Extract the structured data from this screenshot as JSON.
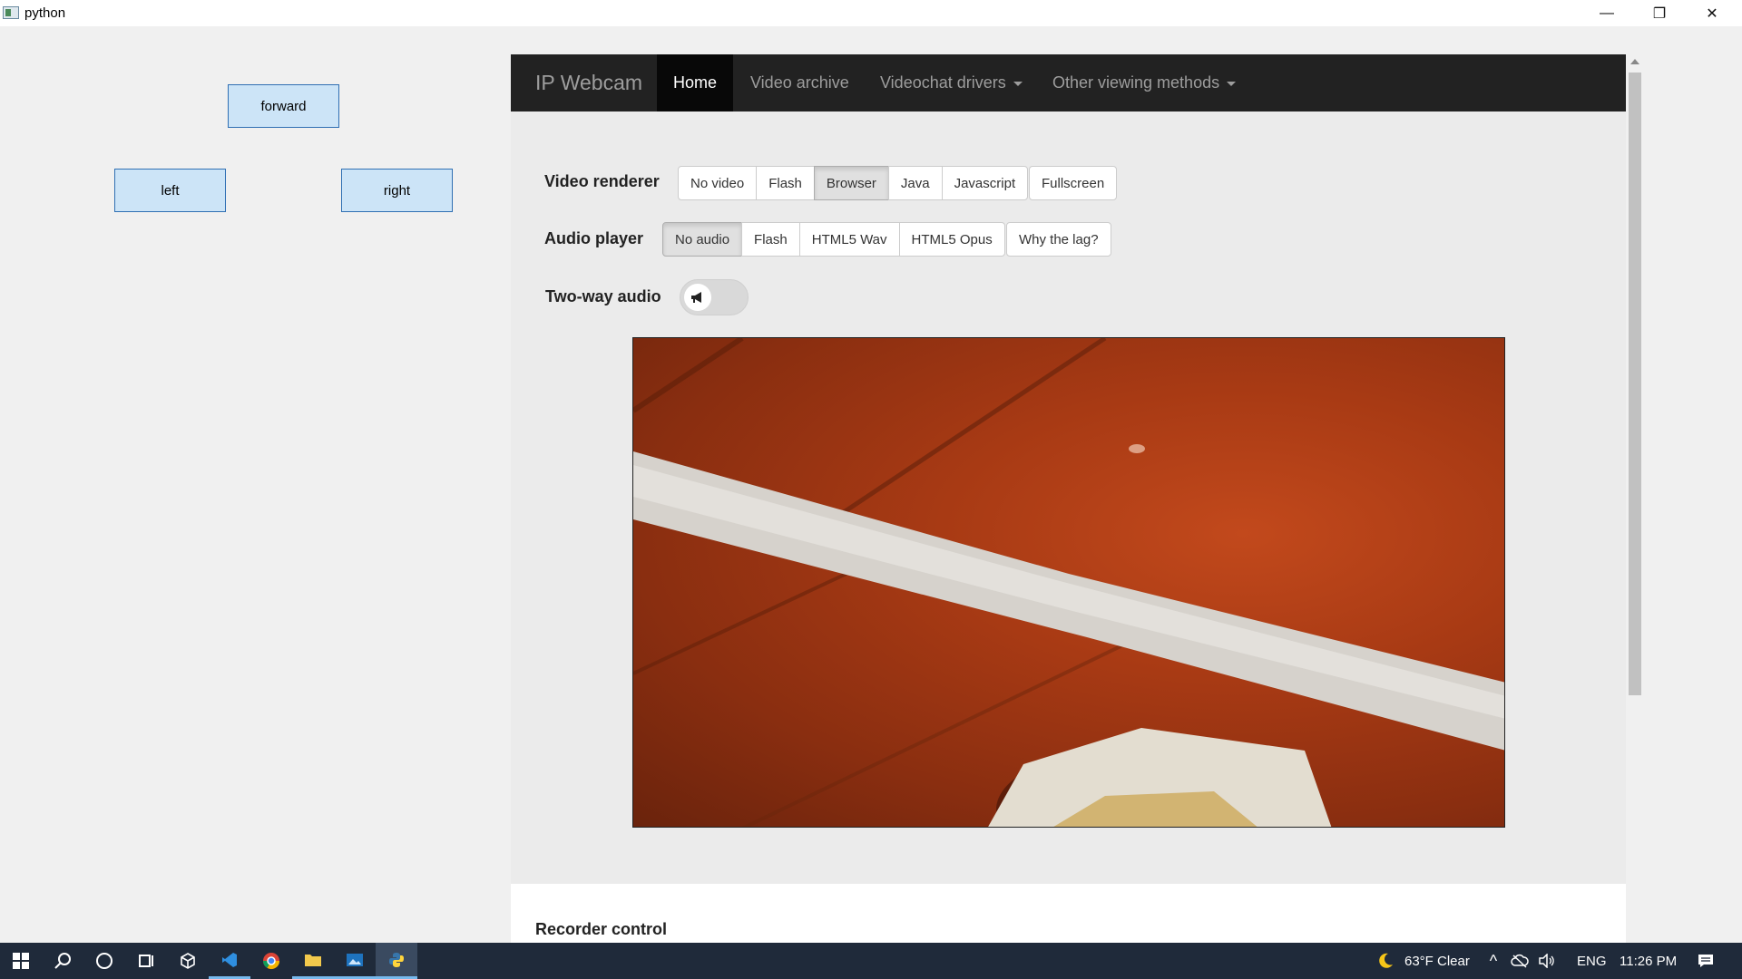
{
  "window": {
    "title": "python"
  },
  "controls": {
    "forward": "forward",
    "left": "left",
    "right": "right"
  },
  "nav": {
    "brand": "IP Webcam",
    "items": [
      "Home",
      "Video archive",
      "Videochat drivers",
      "Other viewing methods"
    ]
  },
  "video_renderer": {
    "label": "Video renderer",
    "options": [
      "No video",
      "Flash",
      "Browser",
      "Java",
      "Javascript"
    ],
    "selected": "Browser",
    "fullscreen": "Fullscreen"
  },
  "audio_player": {
    "label": "Audio player",
    "options": [
      "No audio",
      "Flash",
      "HTML5 Wav",
      "HTML5 Opus"
    ],
    "selected": "No audio",
    "help": "Why the lag?"
  },
  "two_way_audio": {
    "label": "Two-way audio",
    "icon": "megaphone-icon",
    "enabled": false
  },
  "recorder": {
    "title": "Recorder control"
  },
  "taskbar": {
    "weather": "63°F  Clear",
    "language": "ENG",
    "time": "11:26 PM"
  }
}
